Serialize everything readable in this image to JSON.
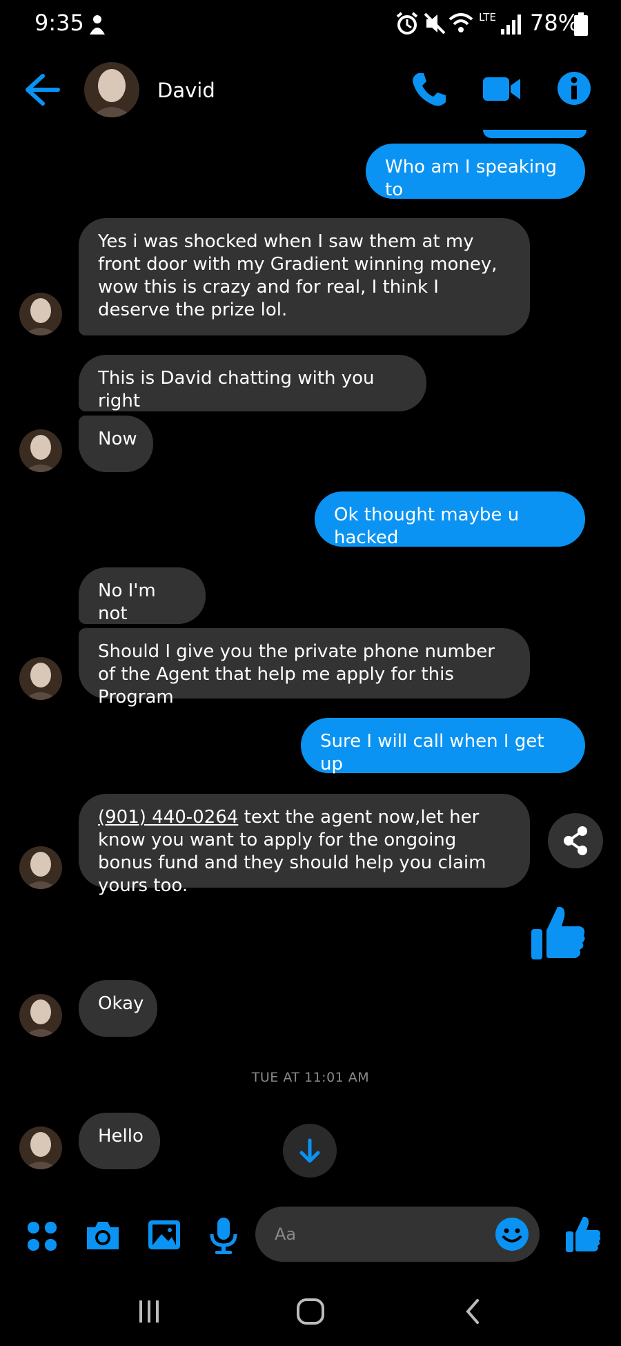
{
  "status_bar": {
    "time": "9:35",
    "network": "LTE",
    "battery": "78%"
  },
  "header": {
    "contact_name": "David",
    "icons": [
      "back-arrow-icon",
      "phone-icon",
      "video-camera-icon",
      "info-icon"
    ]
  },
  "messages": [
    {
      "from": "me",
      "text": "Who am I speaking to"
    },
    {
      "from": "david",
      "text": "Yes i was shocked when I saw them at my front door with my Gradient winning money, wow this is crazy and for real, I think I deserve the prize lol."
    },
    {
      "from": "david",
      "text": "This is David chatting with you right"
    },
    {
      "from": "david",
      "text": "Now"
    },
    {
      "from": "me",
      "text": "Ok thought maybe u hacked"
    },
    {
      "from": "david",
      "text": "No I'm not"
    },
    {
      "from": "david",
      "text": "Should I give you the private phone number of the Agent that help me apply for this Program"
    },
    {
      "from": "me",
      "text": "Sure I will call when I get up"
    },
    {
      "from": "david",
      "link": "(901) 440-0264",
      "text": " text the agent now,let her know you want to apply for the ongoing bonus fund and they should help you claim yours too."
    },
    {
      "from": "me",
      "sticker": "thumbs-up"
    },
    {
      "from": "david",
      "text": "Okay"
    },
    {
      "from": "david",
      "text": "Hello"
    }
  ],
  "timestamp": "TUE AT 11:01 AM",
  "composer": {
    "placeholder": "Aa",
    "icons": [
      "menu-dots-icon",
      "camera-icon",
      "gallery-icon",
      "microphone-icon",
      "emoji-icon",
      "thumbs-up-icon"
    ]
  },
  "colors": {
    "accent": "#0a93f3",
    "incoming_bubble": "#333333",
    "background": "#000000"
  }
}
